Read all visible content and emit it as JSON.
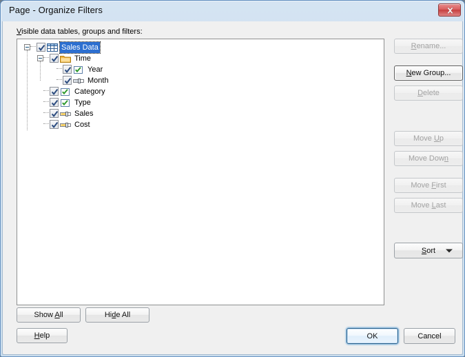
{
  "window": {
    "title": "Page - Organize Filters",
    "close_label": "Close",
    "close_icon": "close-icon"
  },
  "tree_label": {
    "prefix": "V",
    "rest": "isible data tables, groups and filters:"
  },
  "tree": {
    "nodes": [
      {
        "id": "sales-data",
        "label": "Sales Data",
        "depth": 0,
        "icon": "table-icon",
        "checked": true,
        "expander": "collapse",
        "selected": true
      },
      {
        "id": "time",
        "label": "Time",
        "depth": 1,
        "icon": "folder-icon",
        "checked": true,
        "expander": "collapse",
        "selected": false
      },
      {
        "id": "year",
        "label": "Year",
        "depth": 2,
        "icon": "checkbox-filter-icon",
        "checked": true,
        "expander": "none",
        "selected": false
      },
      {
        "id": "month",
        "label": "Month",
        "depth": 2,
        "icon": "range-filter-icon",
        "checked": true,
        "expander": "none",
        "selected": false
      },
      {
        "id": "category",
        "label": "Category",
        "depth": 1,
        "icon": "checkbox-filter-icon",
        "checked": true,
        "expander": "none",
        "selected": false
      },
      {
        "id": "type",
        "label": "Type",
        "depth": 1,
        "icon": "checkbox-filter-icon",
        "checked": true,
        "expander": "none",
        "selected": false
      },
      {
        "id": "sales",
        "label": "Sales",
        "depth": 1,
        "icon": "range-filter-icon",
        "checked": true,
        "expander": "none",
        "selected": false
      },
      {
        "id": "cost",
        "label": "Cost",
        "depth": 1,
        "icon": "range-filter-icon",
        "checked": true,
        "expander": "none",
        "selected": false
      }
    ]
  },
  "side_buttons": {
    "rename": {
      "label": "Rename...",
      "accel": "R",
      "enabled": false
    },
    "new_group": {
      "label": "New Group...",
      "accel": "N",
      "enabled": true
    },
    "delete": {
      "label": "Delete",
      "accel": "D",
      "enabled": false
    },
    "move_up": {
      "label": "Move Up",
      "accel": "U",
      "enabled": false
    },
    "move_down": {
      "label": "Move Down",
      "accel": "n",
      "enabled": false
    },
    "move_first": {
      "label": "Move First",
      "accel": "F",
      "enabled": false
    },
    "move_last": {
      "label": "Move Last",
      "accel": "L",
      "enabled": false
    },
    "sort": {
      "label": "Sort",
      "accel": "S",
      "enabled": true
    }
  },
  "bottom_buttons": {
    "show_all": {
      "label": "Show All",
      "accel": "A"
    },
    "hide_all": {
      "label": "Hide All",
      "accel": "d"
    },
    "help": {
      "label": "Help",
      "accel": "H"
    },
    "ok": {
      "label": "OK"
    },
    "cancel": {
      "label": "Cancel"
    }
  },
  "colors": {
    "selection": "#2d6fd0",
    "folder": "#f2b33d",
    "range_fill": "#f5c02a",
    "check_green": "#2f9a2f",
    "title_gradient_top": "#d5e4f2",
    "close_red": "#c63f3f"
  }
}
